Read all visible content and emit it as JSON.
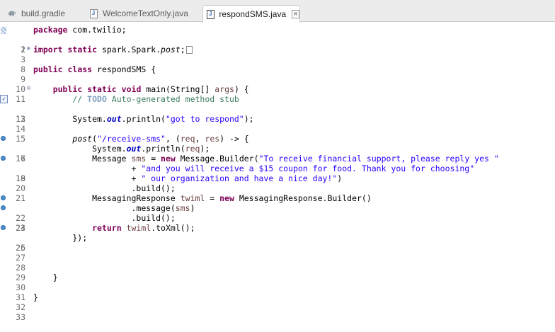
{
  "tabs": [
    {
      "label": "build.gradle",
      "icon": "gradle-elephant-icon",
      "active": false
    },
    {
      "label": "WelcomeTextOnly.java",
      "icon": "java-file-icon",
      "active": false
    },
    {
      "label": "respondSMS.java",
      "icon": "java-file-icon",
      "active": true
    }
  ],
  "editor": {
    "line_numbers": [
      "1",
      "2",
      "3",
      "8",
      "9",
      "10",
      "11",
      "12",
      "13",
      "14",
      "15",
      "16",
      "17",
      "18",
      "19",
      "20",
      "21",
      "22",
      "23",
      "24",
      "25",
      "26",
      "27",
      "28",
      "29",
      "30",
      "31",
      "32",
      "33"
    ],
    "tokens": {
      "l1": [
        "package",
        " com.twilio;"
      ],
      "l3": [
        "import",
        " ",
        "static",
        " spark.Spark.",
        "post",
        ";"
      ],
      "l9": [
        "public",
        " ",
        "class",
        " respondSMS {"
      ],
      "l11": [
        "    ",
        "public",
        " ",
        "static",
        " ",
        "void",
        " main(String[] ",
        "args",
        ") {"
      ],
      "l12": [
        "        // ",
        "TODO",
        " Auto-generated method stub"
      ],
      "l14": [
        "        System.",
        "out",
        ".println(",
        "\"got to respond\"",
        ");"
      ],
      "l16": [
        "        ",
        "post",
        "(",
        "\"/receive-sms\"",
        ", (",
        "req",
        ", ",
        "res",
        ") -> {"
      ],
      "l17": [
        "            System.",
        "out",
        ".println(",
        "req",
        ");"
      ],
      "l18": [
        "            Message ",
        "sms",
        " = ",
        "new",
        " Message.Builder(",
        "\"To receive financial support, please reply yes \""
      ],
      "l19": [
        "                    + ",
        "\"and you will receive a $15 coupon for food. Thank you for choosing\""
      ],
      "l20": [
        "                    + ",
        "\" our organization and have a nice day!\"",
        ")"
      ],
      "l21": [
        "                    .build();"
      ],
      "l22": [
        "            MessagingResponse ",
        "twiml",
        " = ",
        "new",
        " MessagingResponse.Builder()"
      ],
      "l23": [
        "                    .message(",
        "sms",
        ")"
      ],
      "l24": [
        "                    .build();"
      ],
      "l25": [
        "            ",
        "return",
        " ",
        "twiml",
        ".toXml();"
      ],
      "l26": [
        "        });"
      ],
      "l30": [
        "    }"
      ],
      "l32": [
        "}"
      ]
    }
  }
}
